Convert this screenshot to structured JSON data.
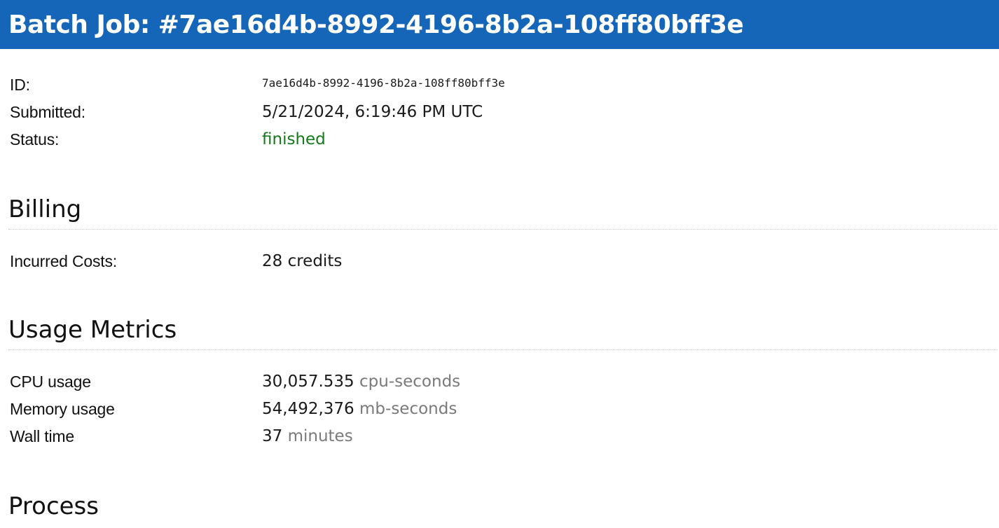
{
  "header": {
    "title": "Batch Job: #7ae16d4b-8992-4196-8b2a-108ff80bff3e"
  },
  "job": {
    "id_label": "ID:",
    "id_value": "7ae16d4b-8992-4196-8b2a-108ff80bff3e",
    "submitted_label": "Submitted:",
    "submitted_value": "5/21/2024, 6:19:46 PM UTC",
    "status_label": "Status:",
    "status_value": "finished",
    "status_color": "#137a1a"
  },
  "billing": {
    "title": "Billing",
    "costs_label": "Incurred Costs:",
    "costs_value": "28 credits"
  },
  "usage": {
    "title": "Usage Metrics",
    "rows": [
      {
        "label": "CPU usage",
        "value": "30,057.535",
        "unit": "cpu-seconds"
      },
      {
        "label": "Memory usage",
        "value": "54,492,376",
        "unit": "mb-seconds"
      },
      {
        "label": "Wall time",
        "value": "37",
        "unit": "minutes"
      }
    ]
  },
  "process": {
    "title": "Process"
  },
  "colors": {
    "header_bg": "#1565b8",
    "unit_gray": "#7a7a7a"
  }
}
